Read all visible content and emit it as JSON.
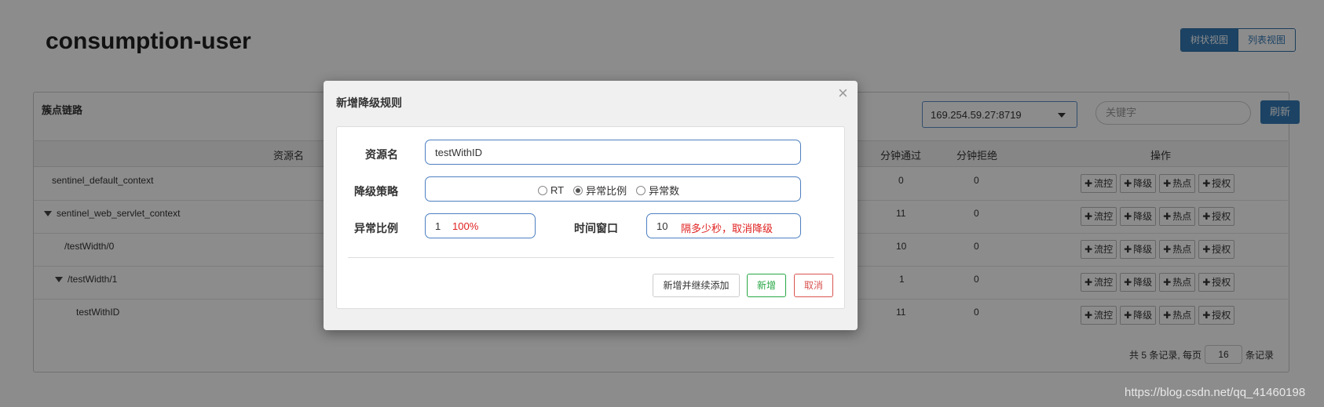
{
  "page": {
    "title": "consumption-user"
  },
  "view_toggle": {
    "tree": "树状视图",
    "list": "列表视图"
  },
  "panel": {
    "title": "簇点链路",
    "machine_select": "169.254.59.27:8719",
    "keyword_placeholder": "关键字",
    "refresh": "刷新"
  },
  "table": {
    "headers": {
      "resource": "资源名",
      "pass": "分钟通过",
      "block": "分钟拒绝",
      "ops": "操作"
    },
    "rows": [
      {
        "name": "sentinel_default_context",
        "pass": "0",
        "block": "0",
        "expanded": false
      },
      {
        "name": "sentinel_web_servlet_context",
        "pass": "11",
        "block": "0",
        "expanded": true
      },
      {
        "name": "/testWidth/0",
        "pass": "10",
        "block": "0",
        "expanded": false
      },
      {
        "name": "/testWidth/1",
        "pass": "1",
        "block": "0",
        "expanded": true
      },
      {
        "name": "testWithID",
        "pass": "11",
        "block": "0",
        "expanded": false
      }
    ],
    "op_labels": {
      "flow": "流控",
      "degrade": "降级",
      "hot": "热点",
      "auth": "授权"
    }
  },
  "pager": {
    "prefix": "共 5 条记录, 每页",
    "size": "16",
    "suffix": "条记录"
  },
  "watermark": "https://blog.csdn.net/qq_41460198",
  "modal": {
    "title": "新增降级规则",
    "close": "×",
    "fields": {
      "resource_label": "资源名",
      "resource_value": "testWithID",
      "strategy_label": "降级策略",
      "strategy_options": [
        "RT",
        "异常比例",
        "异常数"
      ],
      "strategy_selected": "异常比例",
      "ratio_label": "异常比例",
      "ratio_value": "1",
      "ratio_hint": "100%",
      "window_label": "时间窗口",
      "window_value": "10",
      "window_hint": "隔多少秒，取消降级"
    },
    "buttons": {
      "add_continue": "新增并继续添加",
      "add": "新增",
      "cancel": "取消"
    },
    "colors": {
      "add": "#28a745",
      "cancel": "#d9534f",
      "hint": "#e02020"
    }
  }
}
